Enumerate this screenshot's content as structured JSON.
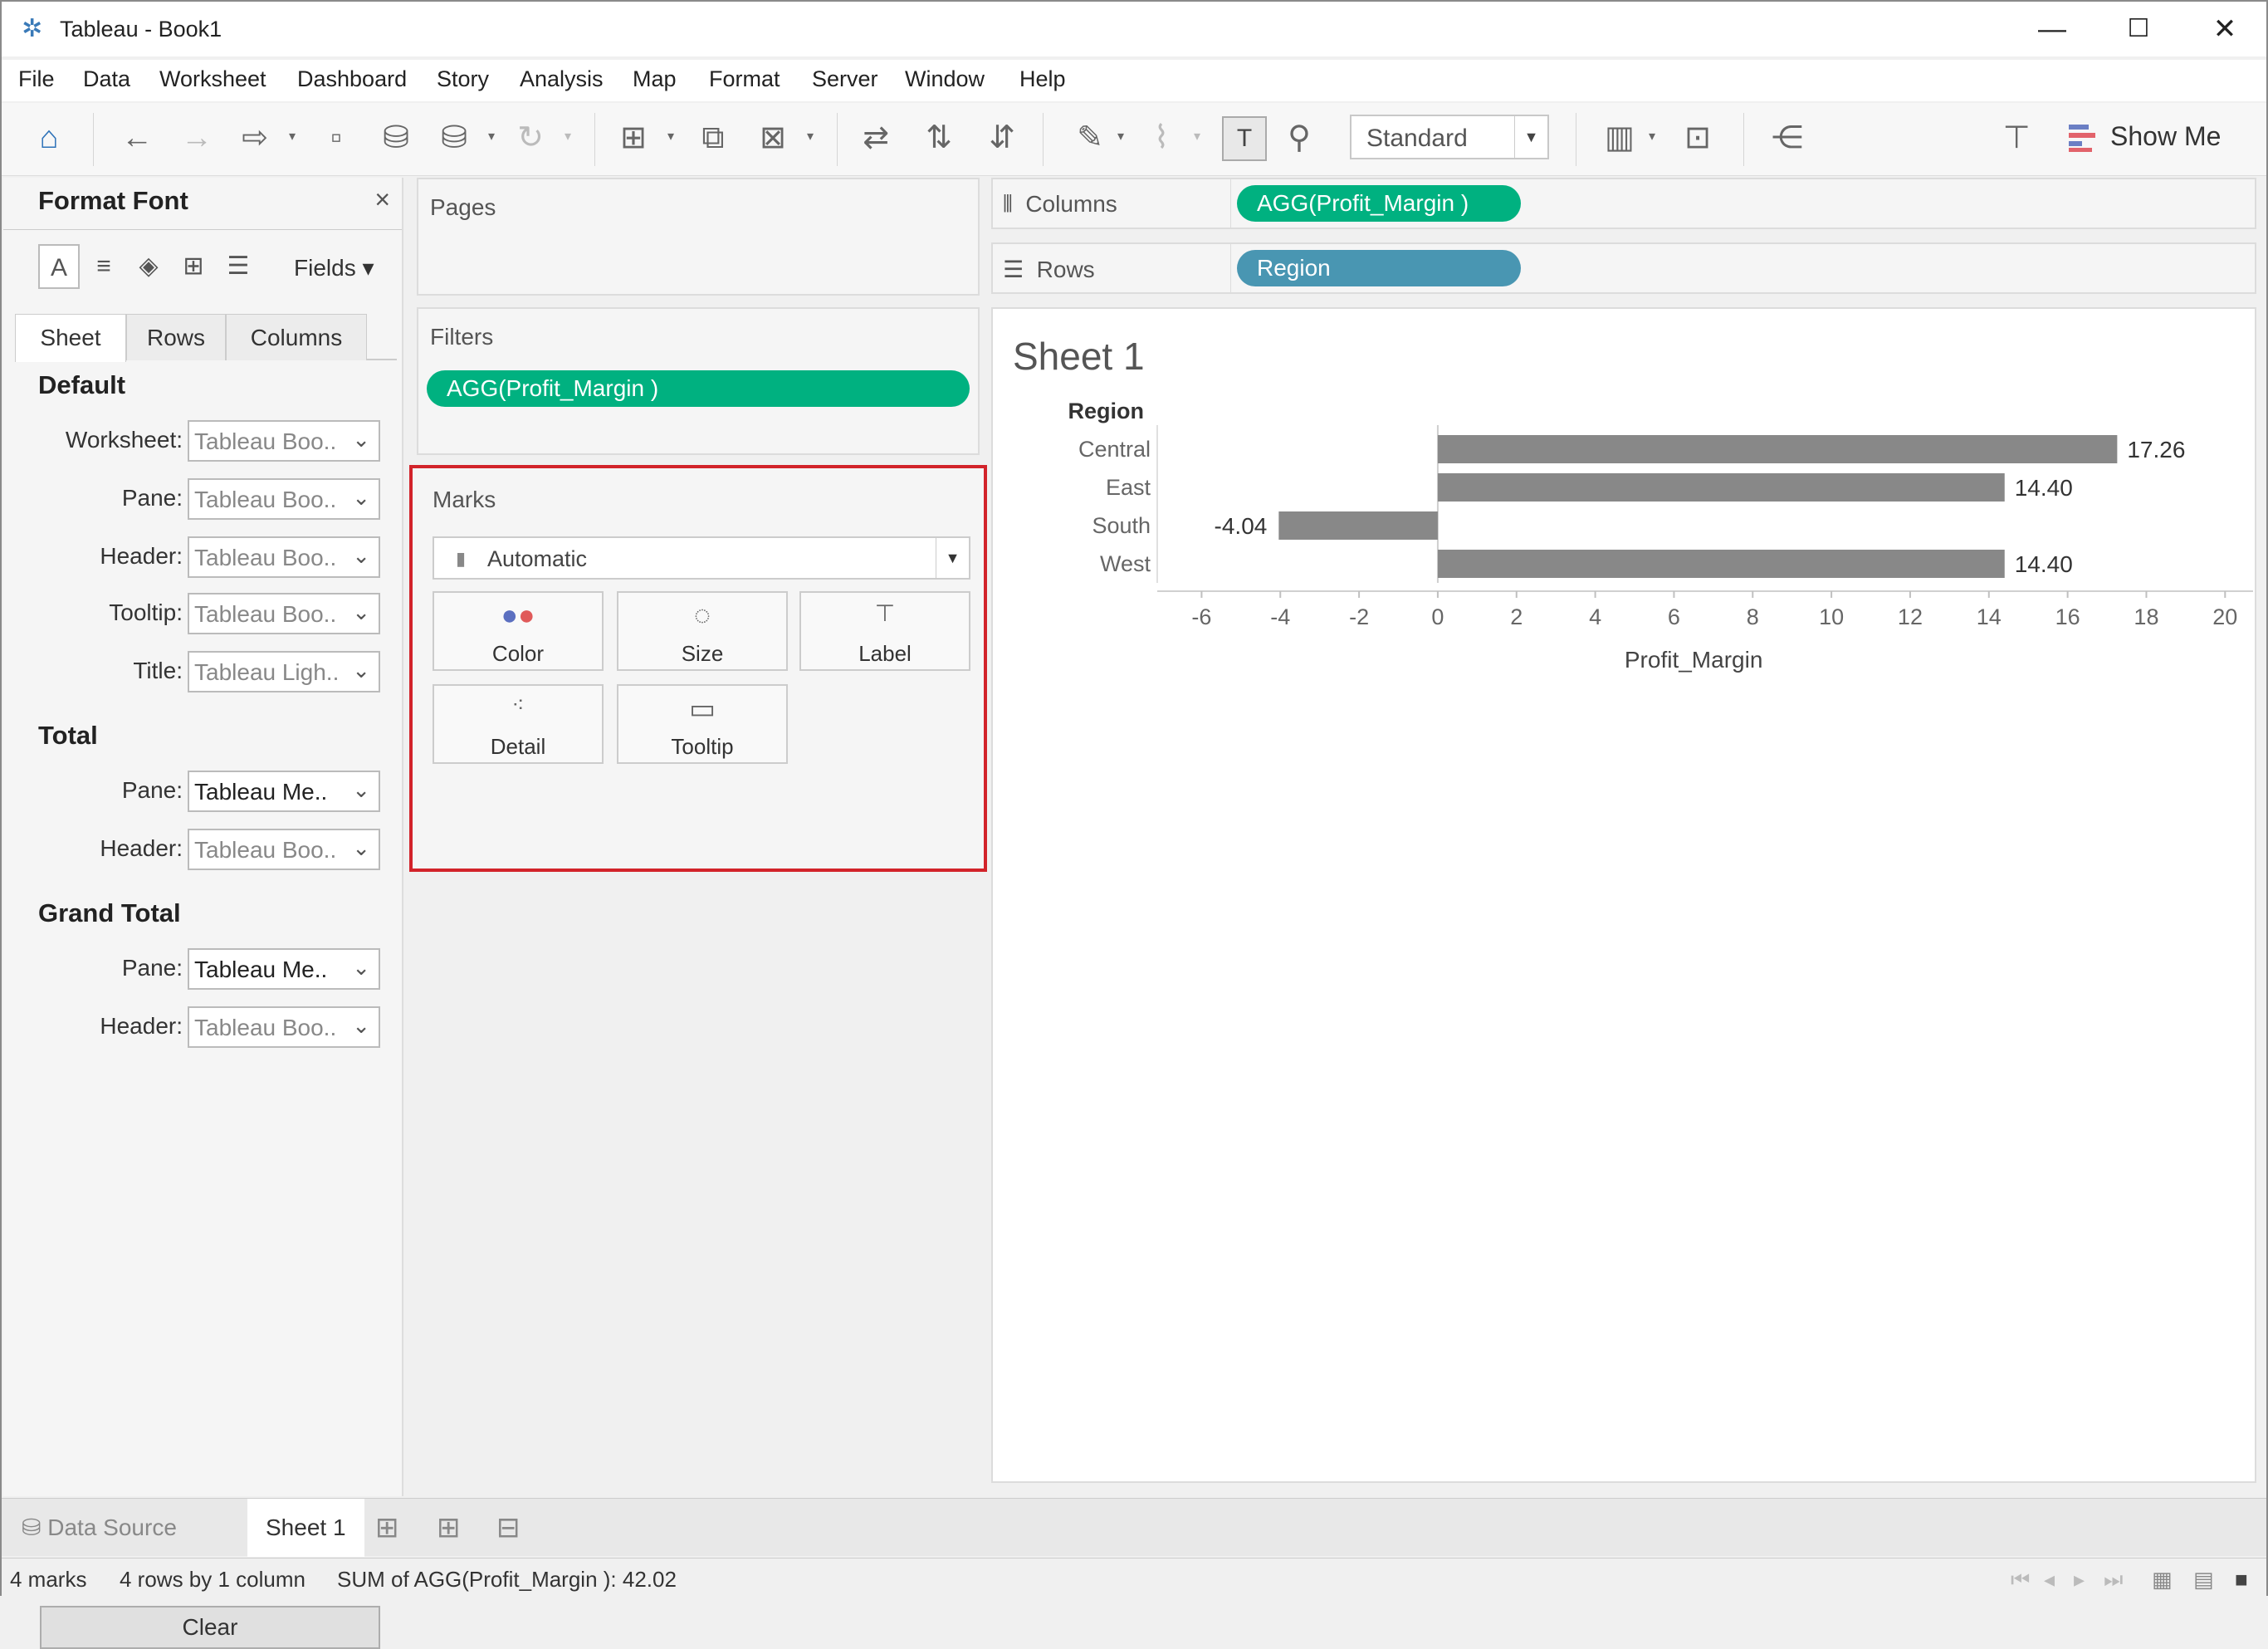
{
  "window": {
    "title": "Tableau - Book1",
    "minimize": "—",
    "maximize": "☐",
    "close": "✕"
  },
  "menu": [
    "File",
    "Data",
    "Worksheet",
    "Dashboard",
    "Story",
    "Analysis",
    "Map",
    "Format",
    "Server",
    "Window",
    "Help"
  ],
  "toolbar": {
    "fit_select": "Standard",
    "show_me": "Show Me"
  },
  "format_pane": {
    "title": "Format Font",
    "fields_button": "Fields ▾",
    "tabs": [
      "Sheet",
      "Rows",
      "Columns"
    ],
    "sections": {
      "default": {
        "title": "Default",
        "rows": [
          {
            "label": "Worksheet:",
            "value": "Tableau Boo.."
          },
          {
            "label": "Pane:",
            "value": "Tableau Boo.."
          },
          {
            "label": "Header:",
            "value": "Tableau Boo.."
          },
          {
            "label": "Tooltip:",
            "value": "Tableau Boo.."
          },
          {
            "label": "Title:",
            "value": "Tableau Ligh.."
          }
        ]
      },
      "total": {
        "title": "Total",
        "rows": [
          {
            "label": "Pane:",
            "value": "Tableau Me.."
          },
          {
            "label": "Header:",
            "value": "Tableau Boo.."
          }
        ]
      },
      "grand_total": {
        "title": "Grand Total",
        "rows": [
          {
            "label": "Pane:",
            "value": "Tableau Me.."
          },
          {
            "label": "Header:",
            "value": "Tableau Boo.."
          }
        ]
      }
    },
    "clear_button": "Clear"
  },
  "pages": {
    "label": "Pages"
  },
  "filters": {
    "label": "Filters",
    "pill": "AGG(Profit_Margin )"
  },
  "marks": {
    "label": "Marks",
    "type": "Automatic",
    "buttons": [
      "Color",
      "Size",
      "Label",
      "Detail",
      "Tooltip"
    ]
  },
  "shelves": {
    "columns_label": "Columns",
    "columns_pill": "AGG(Profit_Margin )",
    "rows_label": "Rows",
    "rows_pill": "Region"
  },
  "sheet": {
    "title": "Sheet 1"
  },
  "chart_data": {
    "type": "bar",
    "orientation": "horizontal",
    "row_header": "Region",
    "categories": [
      "Central",
      "East",
      "South",
      "West"
    ],
    "values": [
      17.26,
      14.4,
      -4.04,
      14.4
    ],
    "value_labels": [
      "17.26",
      "14.40",
      "-4.04",
      "14.40"
    ],
    "xlabel": "Profit_Margin",
    "xlim": [
      -7,
      20.5
    ],
    "xticks": [
      -6,
      -4,
      -2,
      0,
      2,
      4,
      6,
      8,
      10,
      12,
      14,
      16,
      18,
      20
    ],
    "bar_color": "#888888",
    "grid": false
  },
  "bottom_tabs": {
    "data_source": "Data Source",
    "sheet1": "Sheet 1"
  },
  "status": {
    "marks": "4 marks",
    "dims": "4 rows by 1 column",
    "sum": "SUM of AGG(Profit_Margin ): 42.02"
  }
}
